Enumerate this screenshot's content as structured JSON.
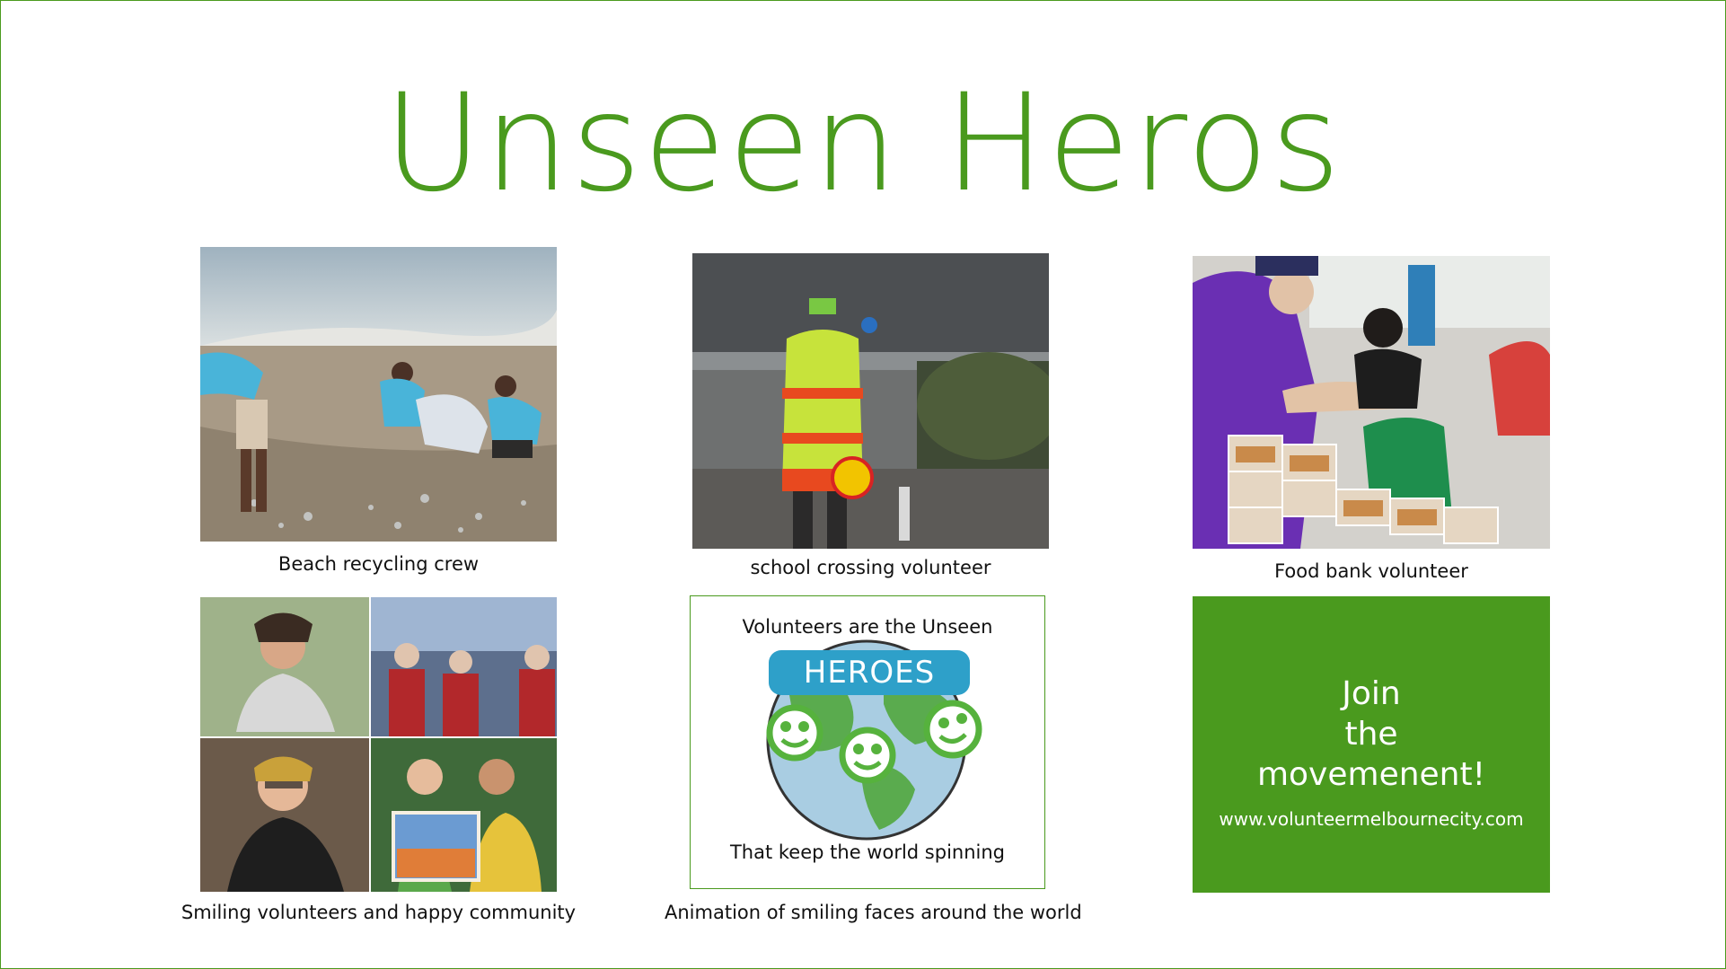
{
  "slide": {
    "title": "Unseen Heros",
    "accent_color": "#4a9a1e",
    "tiles": [
      {
        "caption": "Beach recycling crew",
        "image": "beach-cleanup-photo"
      },
      {
        "caption": "school crossing volunteer",
        "image": "crossing-guard-photo"
      },
      {
        "caption": "Food bank volunteer",
        "image": "food-bank-photo"
      },
      {
        "caption": "Smiling volunteers and happy community",
        "image": "volunteer-collage-photo"
      },
      {
        "caption": "Animation of smiling faces around the world",
        "image": "smiling-globe-animation"
      }
    ],
    "animation": {
      "line1": "Volunteers are the Unseen",
      "pill": "HEROES",
      "line2": "That keep the world spinning"
    },
    "join": {
      "line1": "Join",
      "line2": "the",
      "line3": "movemenent!",
      "url": "www.volunteermelbournecity.com"
    }
  }
}
